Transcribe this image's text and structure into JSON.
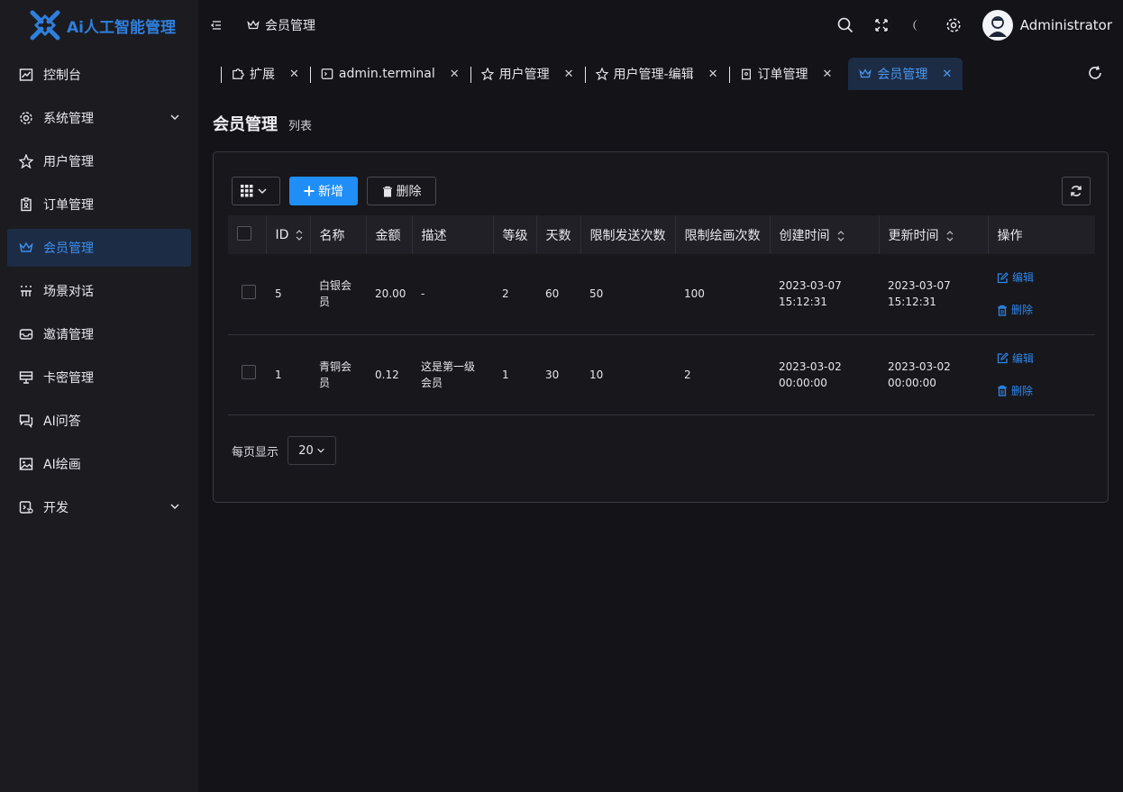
{
  "app": {
    "title": "Ai人工智能管理"
  },
  "header": {
    "breadcrumb": "会员管理",
    "username": "Administrator"
  },
  "sidebar": {
    "items": [
      {
        "label": "控制台",
        "icon": "dashboard-icon"
      },
      {
        "label": "系统管理",
        "icon": "gear-icon",
        "expandable": true
      },
      {
        "label": "用户管理",
        "icon": "user-star-icon"
      },
      {
        "label": "订单管理",
        "icon": "clipboard-icon"
      },
      {
        "label": "会员管理",
        "icon": "crown-icon",
        "active": true
      },
      {
        "label": "场景对话",
        "icon": "scene-icon"
      },
      {
        "label": "邀请管理",
        "icon": "inbox-icon"
      },
      {
        "label": "卡密管理",
        "icon": "card-icon"
      },
      {
        "label": "AI问答",
        "icon": "chat-icon"
      },
      {
        "label": "AI绘画",
        "icon": "image-icon"
      },
      {
        "label": "开发",
        "icon": "dev-icon",
        "expandable": true
      }
    ]
  },
  "tabs": [
    {
      "label": "扩展",
      "icon": "puzzle-icon"
    },
    {
      "label": "admin.terminal",
      "icon": "terminal-icon"
    },
    {
      "label": "用户管理",
      "icon": "user-star-icon"
    },
    {
      "label": "用户管理-编辑",
      "icon": "user-star-icon"
    },
    {
      "label": "订单管理",
      "icon": "clipboard-icon"
    },
    {
      "label": "会员管理",
      "icon": "crown-icon",
      "active": true
    }
  ],
  "page": {
    "title": "会员管理",
    "subtitle": "列表"
  },
  "toolbar": {
    "add_label": "新增",
    "delete_label": "删除"
  },
  "table": {
    "columns": [
      "ID",
      "名称",
      "金额",
      "描述",
      "等级",
      "天数",
      "限制发送次数",
      "限制绘画次数",
      "创建时间",
      "更新时间",
      "操作"
    ],
    "rows": [
      {
        "id": "5",
        "name": "白银会员",
        "amount": "20.00",
        "desc": "-",
        "level": "2",
        "days": "60",
        "send_limit": "50",
        "draw_limit": "100",
        "created_date": "2023-03-07",
        "created_time": "15:12:31",
        "updated_date": "2023-03-07",
        "updated_time": "15:12:31"
      },
      {
        "id": "1",
        "name": "青铜会员",
        "amount": "0.12",
        "desc": "这是第一级会员",
        "level": "1",
        "days": "30",
        "send_limit": "10",
        "draw_limit": "2",
        "created_date": "2023-03-02",
        "created_time": "00:00:00",
        "updated_date": "2023-03-02",
        "updated_time": "00:00:00"
      }
    ],
    "edit_label": "编辑",
    "delete_label": "删除"
  },
  "pager": {
    "label": "每页显示",
    "page_size": "20"
  },
  "colors": {
    "accent": "#1f8ff7",
    "active_bg": "#1d2c45",
    "link": "#2f86ea"
  }
}
